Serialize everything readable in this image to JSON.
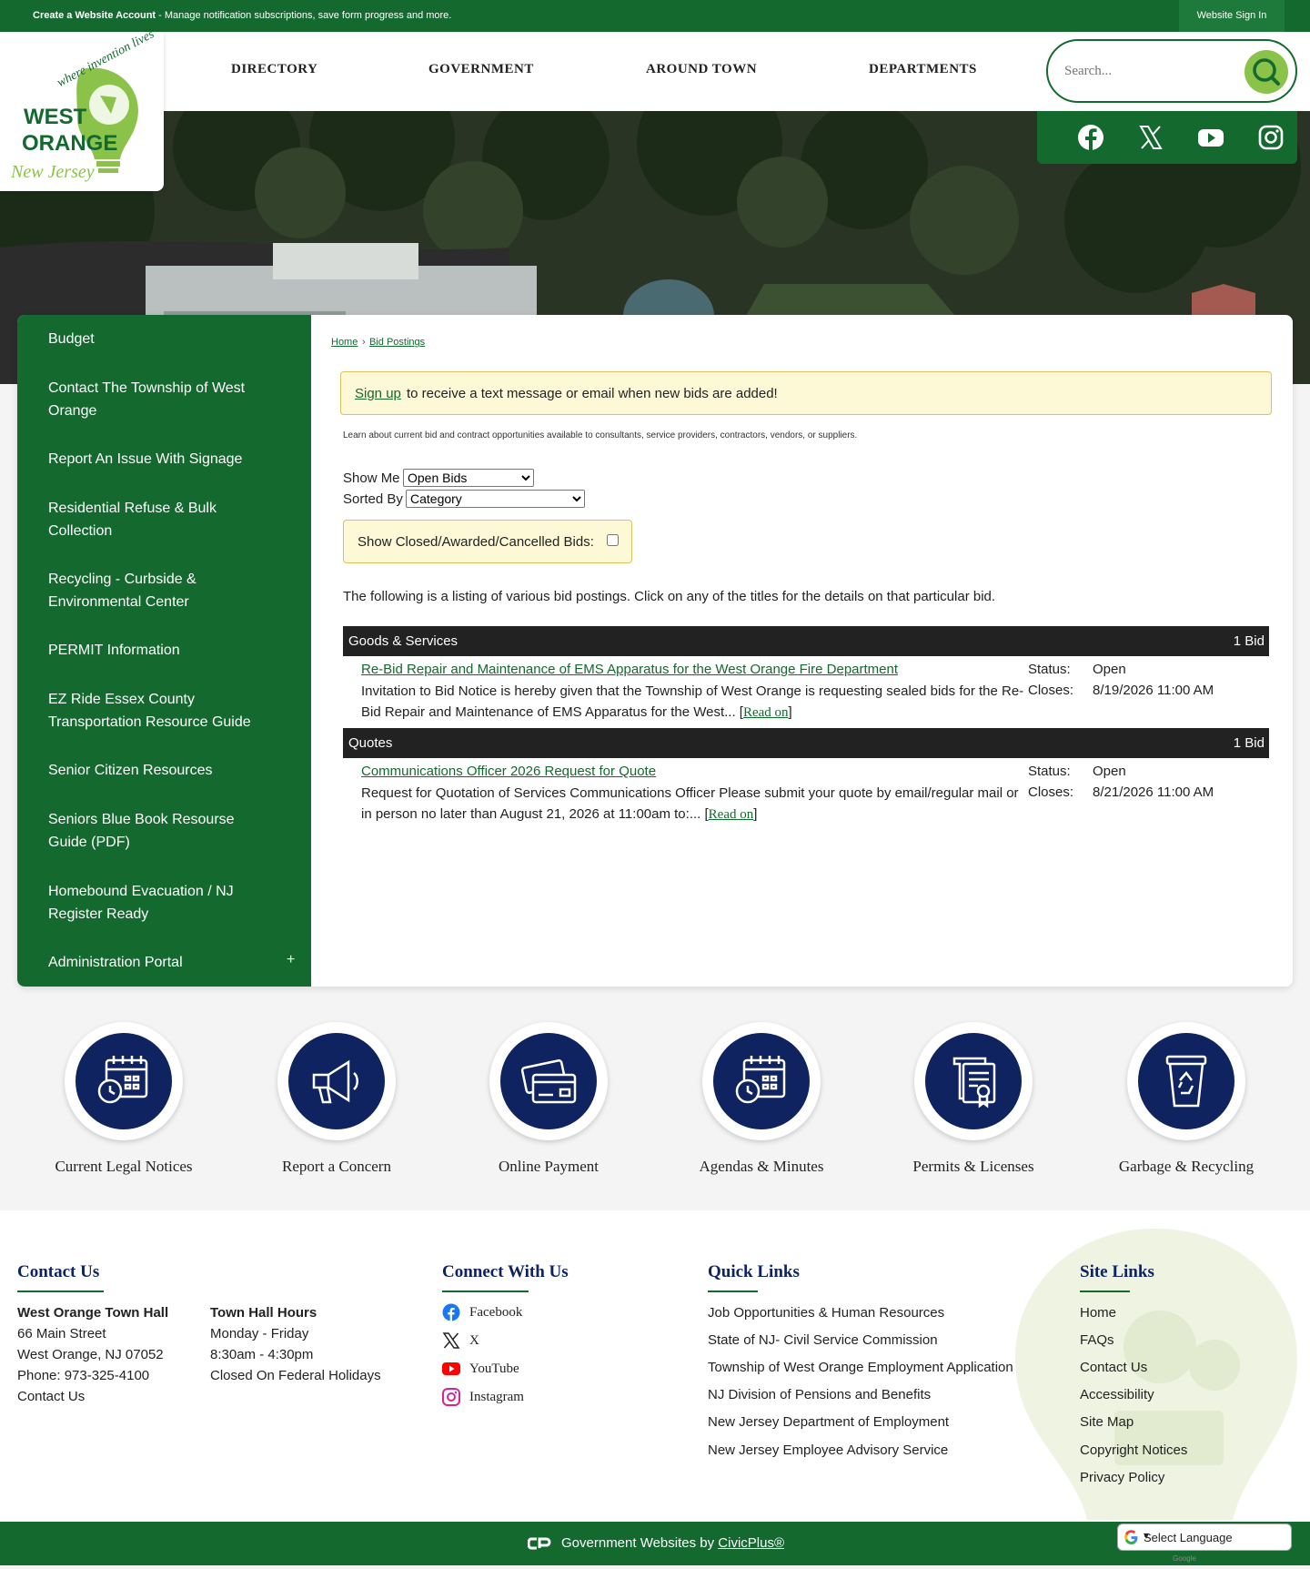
{
  "topbar": {
    "account_bold": "Create a Website Account",
    "account_rest": " - Manage notification subscriptions, save form progress and more.",
    "signin": "Website Sign In"
  },
  "logo": {
    "line1": "where invention lives",
    "line2": "WEST",
    "line3": "ORANGE",
    "line4": "New Jersey"
  },
  "nav": [
    "DIRECTORY",
    "GOVERNMENT",
    "AROUND TOWN",
    "DEPARTMENTS"
  ],
  "search": {
    "placeholder": "Search..."
  },
  "social": [
    "facebook-icon",
    "x-icon",
    "youtube-icon",
    "instagram-icon"
  ],
  "sidebar": {
    "items": [
      "Budget",
      "Contact The Township of West Orange",
      "Report An Issue With Signage",
      "Residential Refuse & Bulk Collection",
      "Recycling - Curbside & Environmental Center",
      "PERMIT Information",
      "EZ Ride Essex County Transportation Resource Guide",
      "Senior Citizen Resources",
      "Seniors Blue Book Resourse Guide (PDF)",
      "Homebound Evacuation / NJ Register Ready",
      "Administration Portal"
    ],
    "expand": "+"
  },
  "breadcrumb": {
    "home": "Home",
    "sep": "›",
    "current": "Bid Postings"
  },
  "alert": {
    "link": "Sign up",
    "rest": "to receive a text message or email when new bids are added!"
  },
  "intro": "Learn about current bid and contract opportunities available to consultants, service providers, contractors, vendors, or suppliers.",
  "filters": {
    "show_me_label": "Show Me",
    "show_me_value": "Open Bids",
    "sorted_by_label": "Sorted By",
    "sorted_by_value": "Category",
    "closed_label": "Show Closed/Awarded/Cancelled Bids:"
  },
  "listing_text": "The following is a listing of various bid postings. Click on any of the titles for the details on that particular bid.",
  "categories": [
    {
      "name": "Goods & Services",
      "count": "1 Bid",
      "bid": {
        "title": "Re-Bid Repair and Maintenance of EMS Apparatus for the West Orange Fire Department",
        "desc": "Invitation to Bid Notice is hereby given that the Township of West Orange is requesting sealed bids for the Re-Bid Repair and Maintenance of EMS Apparatus for the West...",
        "read_on": "Read on",
        "status_label": "Status:",
        "status": "Open",
        "closes_label": "Closes:",
        "closes": "8/19/2026 11:00 AM"
      }
    },
    {
      "name": "Quotes",
      "count": "1 Bid",
      "bid": {
        "title": "Communications Officer 2026 Request for Quote",
        "desc": "Request for Quotation of Services Communications Officer Please submit your quote by email/regular mail or in person no later than August 21, 2026 at 11:00am to:...",
        "read_on": "Read on",
        "status_label": "Status:",
        "status": "Open",
        "closes_label": "Closes:",
        "closes": "8/21/2026 11:00 AM"
      }
    }
  ],
  "quick_links": [
    {
      "label": "Current Legal Notices",
      "icon": "calendar-clock-icon"
    },
    {
      "label": "Report a Concern",
      "icon": "megaphone-icon"
    },
    {
      "label": "Online Payment",
      "icon": "credit-card-icon"
    },
    {
      "label": "Agendas & Minutes",
      "icon": "calendar-clock-icon"
    },
    {
      "label": "Permits & Licenses",
      "icon": "certificate-icon"
    },
    {
      "label": "Garbage & Recycling",
      "icon": "recycle-bin-icon"
    }
  ],
  "footer": {
    "contact": {
      "heading": "Contact Us",
      "name": "West Orange Town Hall",
      "address1": "66 Main Street",
      "address2": "West Orange, NJ 07052",
      "phone": "Phone: 973-325-4100",
      "link": "Contact Us",
      "hours_heading": "Town Hall Hours",
      "hours1": "Monday - Friday",
      "hours2": "8:30am - 4:30pm",
      "hours3": "Closed On Federal Holidays"
    },
    "connect": {
      "heading": "Connect With Us",
      "items": [
        "Facebook",
        "X",
        "YouTube",
        "Instagram"
      ]
    },
    "quick": {
      "heading": "Quick Links",
      "items": [
        "Job Opportunities & Human Resources",
        "State of NJ- Civil Service Commission",
        "Township of West Orange Employment Application",
        "NJ Division of Pensions and Benefits",
        "New Jersey Department of Employment",
        "New Jersey Employee Advisory Service"
      ]
    },
    "site": {
      "heading": "Site Links",
      "items": [
        "Home",
        "FAQs",
        "Contact Us",
        "Accessibility",
        "Site Map",
        "Copyright Notices",
        "Privacy Policy"
      ]
    }
  },
  "bottombar": {
    "prefix": "Government Websites by ",
    "link": "CivicPlus®"
  },
  "language": {
    "label": "Select Language",
    "powered": "Google"
  },
  "colors": {
    "green": "#14692f",
    "navy": "#0e2360",
    "lime": "#8bc34a",
    "alert_bg": "#fdf8d5"
  }
}
